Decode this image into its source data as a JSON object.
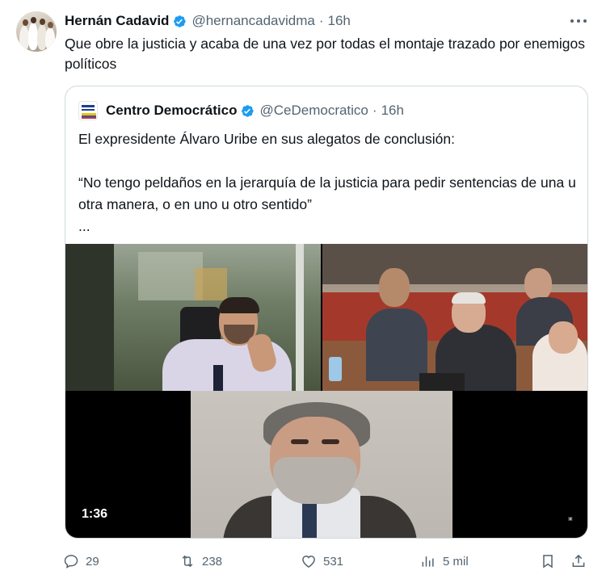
{
  "author": {
    "name": "Hernán Cadavid",
    "handle": "@hernancadavidma",
    "separator": "·",
    "time": "16h"
  },
  "tweet_text": "Que obre la justicia y acaba de una vez por todas el montaje trazado por enemigos políticos",
  "quoted": {
    "name": "Centro Democrático",
    "handle": "@CeDemocratico",
    "separator": "·",
    "time": "16h",
    "line1": "El expresidente Álvaro Uribe en sus alegatos de conclusión:",
    "line2": "“No tengo peldaños en la jerarquía de la justicia para pedir sentencias de una u otra manera, o en uno u otro sentido”",
    "line3": "...",
    "video_duration": "1:36"
  },
  "actions": {
    "replies": "29",
    "reposts": "238",
    "likes": "531",
    "views": "5 mil"
  },
  "colors": {
    "text": "#0f1419",
    "secondary": "#536471",
    "verified": "#1d9bf0",
    "border": "#cfd9de"
  },
  "icons": [
    "verified-badge-icon",
    "more-icon",
    "reply-icon",
    "repost-icon",
    "like-icon",
    "views-icon",
    "bookmark-icon",
    "share-icon"
  ]
}
